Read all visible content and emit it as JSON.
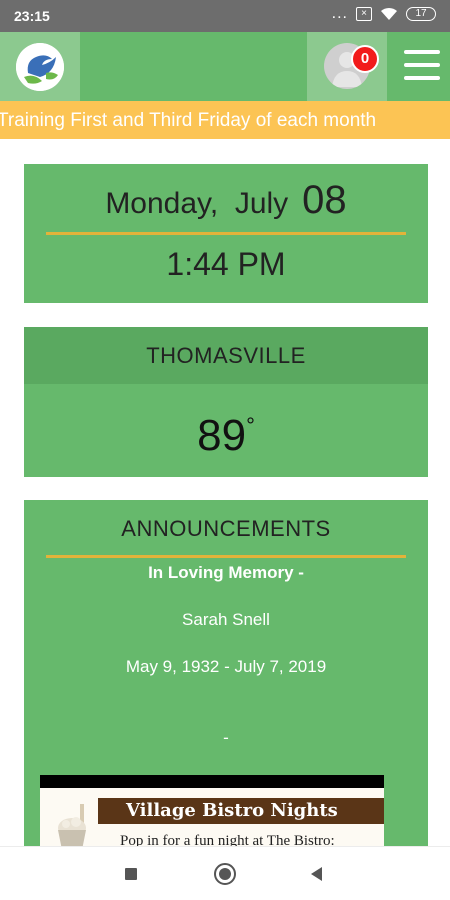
{
  "status_bar": {
    "time": "23:15",
    "dots": "...",
    "battery": "17",
    "icons": [
      "sim-x-icon",
      "wifi-icon",
      "battery-icon"
    ]
  },
  "header": {
    "logo_icon": "dove-logo-icon",
    "avatar_icon": "user-avatar-icon",
    "notification_count": "0",
    "menu_icon": "hamburger-menu-icon"
  },
  "ticker": {
    "text": "Training First and Third Friday of each month"
  },
  "date_card": {
    "weekday_month": "Monday,  July",
    "day": "08",
    "time": "1:44 PM"
  },
  "weather_card": {
    "location": "THOMASVILLE",
    "temperature": "89",
    "degree": "°"
  },
  "announcements": {
    "title": "ANNOUNCEMENTS",
    "heading": "In Loving Memory -",
    "name": "Sarah Snell",
    "dates": "May 9, 1932 - July 7, 2019",
    "separator": "-",
    "image_banner": "Village Bistro Nights",
    "image_subtitle": "Pop in for a fun night at The Bistro:"
  },
  "colors": {
    "green": "#66b96c",
    "header_green": "#5aa960",
    "ticker": "#fcc454",
    "gold_line": "#e2b33a",
    "badge_red": "#f21b1b"
  },
  "nav": {
    "icons": [
      "recent-apps-icon",
      "home-icon",
      "back-icon"
    ]
  }
}
